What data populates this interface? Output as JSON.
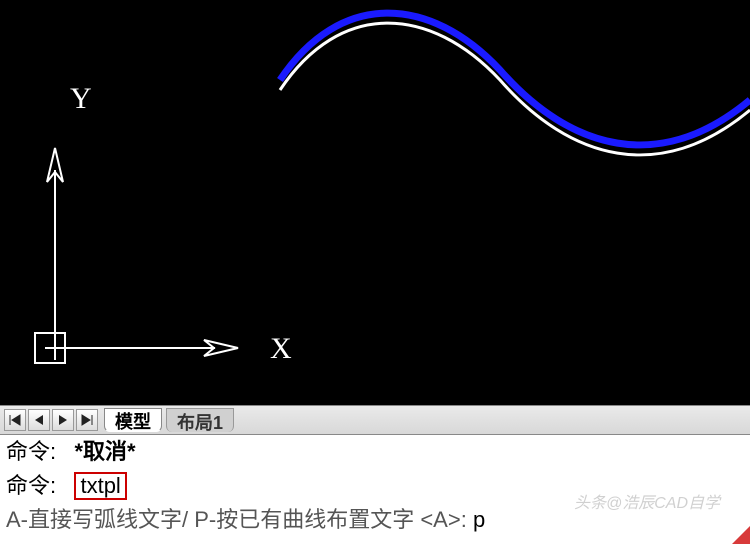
{
  "viewport": {
    "axis_x_label": "X",
    "axis_y_label": "Y"
  },
  "tabs": {
    "nav_first": "|◀",
    "nav_prev": "◀",
    "nav_next": "▶",
    "nav_last": "▶|",
    "active": "模型",
    "inactive1": "布局1"
  },
  "command": {
    "prompt1_label": "命令:",
    "prompt1_text": "*取消*",
    "prompt2_label": "命令:",
    "prompt2_text": "txtpl",
    "hint_a": "A-直接写弧线文字/ P-按已有曲线布置文字 <A>:",
    "hint_input": "p"
  },
  "watermark": "头条@浩辰CAD自学"
}
